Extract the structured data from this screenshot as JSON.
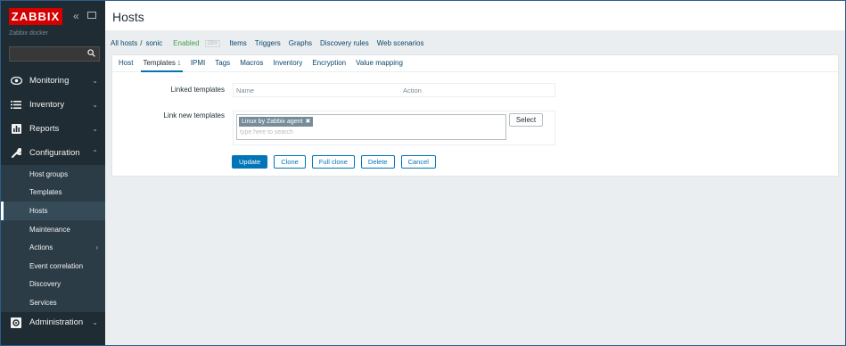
{
  "sidebar": {
    "logo": "ZABBIX",
    "server_name": "Zabbix docker",
    "menu": [
      {
        "label": "Monitoring",
        "icon": "eye-icon"
      },
      {
        "label": "Inventory",
        "icon": "list-icon"
      },
      {
        "label": "Reports",
        "icon": "bar-chart-icon"
      },
      {
        "label": "Configuration",
        "icon": "wrench-icon"
      }
    ],
    "config_submenu": [
      "Host groups",
      "Templates",
      "Hosts",
      "Maintenance",
      "Actions",
      "Event correlation",
      "Discovery",
      "Services"
    ],
    "admin": {
      "label": "Administration",
      "icon": "gear-icon"
    }
  },
  "header": {
    "title": "Hosts"
  },
  "breadcrumb": {
    "all_hosts": "All hosts",
    "separator": "/",
    "current": "sonic",
    "status": "Enabled",
    "zbx": "ZBX",
    "links": [
      "Items",
      "Triggers",
      "Graphs",
      "Discovery rules",
      "Web scenarios"
    ]
  },
  "tabs": [
    {
      "label": "Host",
      "count": ""
    },
    {
      "label": "Templates",
      "count": "1"
    },
    {
      "label": "IPMI",
      "count": ""
    },
    {
      "label": "Tags",
      "count": ""
    },
    {
      "label": "Macros",
      "count": ""
    },
    {
      "label": "Inventory",
      "count": ""
    },
    {
      "label": "Encryption",
      "count": ""
    },
    {
      "label": "Value mapping",
      "count": ""
    }
  ],
  "form": {
    "linked_label": "Linked templates",
    "col_name": "Name",
    "col_action": "Action",
    "link_new_label": "Link new templates",
    "selected_template": "Linux by Zabbix agent",
    "placeholder": "type here to search",
    "select_button": "Select",
    "buttons": [
      "Update",
      "Clone",
      "Full clone",
      "Delete",
      "Cancel"
    ]
  },
  "colors": {
    "sidebar": "#1f2c33",
    "accent": "#0275b8",
    "logo": "#d40000",
    "enabled": "#429e47"
  }
}
